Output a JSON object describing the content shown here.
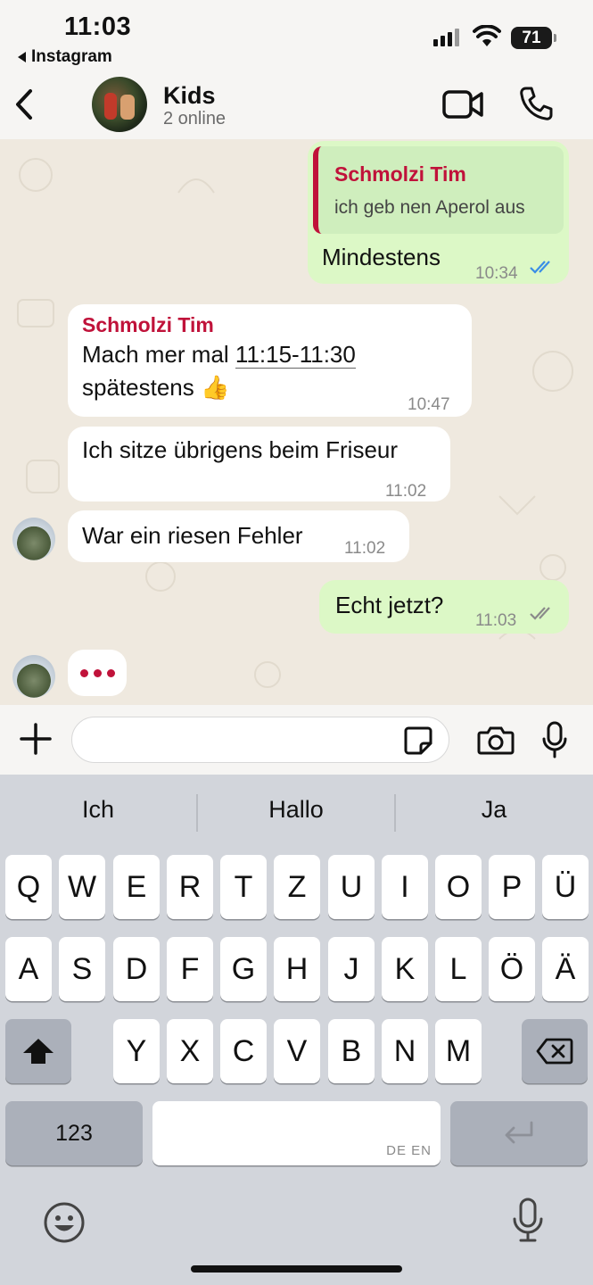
{
  "status": {
    "time": "11:03",
    "back_app": "Instagram",
    "battery": "71"
  },
  "header": {
    "title": "Kids",
    "subtitle": "2 online"
  },
  "messages": {
    "m1": {
      "quote_sender": "Schmolzi Tim",
      "quote_text": "ich geb nen Aperol aus",
      "text": "Mindestens",
      "time": "10:34"
    },
    "m2": {
      "sender": "Schmolzi Tim",
      "line1_pre": "Mach mer mal ",
      "line1_link": "11:15-11:30",
      "line2": "spätestens 👍",
      "time": "10:47"
    },
    "m3": {
      "text": "Ich sitze übrigens beim Friseur",
      "time": "11:02"
    },
    "m4": {
      "text": "War ein riesen Fehler",
      "time": "11:02"
    },
    "m5": {
      "text": "Echt jetzt?",
      "time": "11:03"
    },
    "typing": "•••"
  },
  "input": {
    "placeholder": ""
  },
  "keyboard": {
    "suggestions": [
      "Ich",
      "Hallo",
      "Ja"
    ],
    "row1": [
      "Q",
      "W",
      "E",
      "R",
      "T",
      "Z",
      "U",
      "I",
      "O",
      "P",
      "Ü"
    ],
    "row2": [
      "A",
      "S",
      "D",
      "F",
      "G",
      "H",
      "J",
      "K",
      "L",
      "Ö",
      "Ä"
    ],
    "row3": [
      "Y",
      "X",
      "C",
      "V",
      "B",
      "N",
      "M"
    ],
    "numbers_label": "123",
    "space_lang": "DE EN"
  },
  "colors": {
    "accent": "#c0123a",
    "outgoing": "#dcf8c6",
    "incoming": "#ffffff",
    "read_ticks": "#3a8ee6"
  }
}
